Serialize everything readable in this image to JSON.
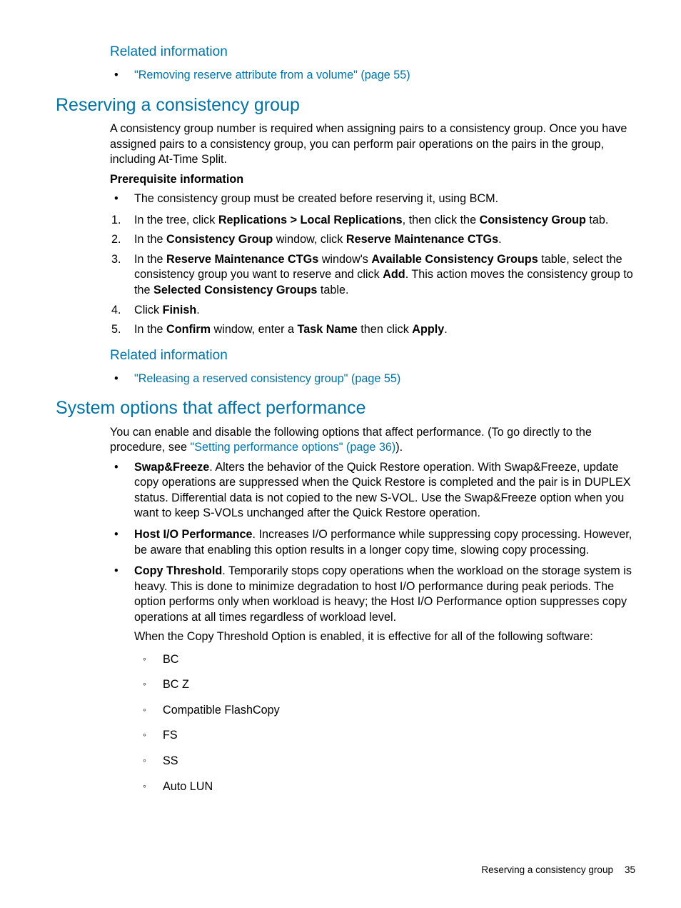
{
  "sec1": {
    "heading": "Related information",
    "link": "\"Removing reserve attribute from a volume\" (page 55)"
  },
  "sec2": {
    "heading": "Reserving a consistency group",
    "intro": "A consistency group number is required when assigning pairs to a consistency group. Once you have assigned pairs to a consistency group, you can perform pair operations on the pairs in the group, including At-Time Split.",
    "prereq_label": "Prerequisite information",
    "prereq_bullet": "The consistency group must be created before reserving it, using BCM.",
    "step1_a": "In the tree, click ",
    "step1_b": "Replications > Local Replications",
    "step1_c": ", then click the ",
    "step1_d": "Consistency Group",
    "step1_e": " tab.",
    "step2_a": "In the ",
    "step2_b": "Consistency Group",
    "step2_c": " window, click ",
    "step2_d": "Reserve Maintenance CTGs",
    "step2_e": ".",
    "step3_a": "In the ",
    "step3_b": "Reserve Maintenance CTGs",
    "step3_c": " window's ",
    "step3_d": "Available Consistency Groups",
    "step3_e": " table, select the consistency group you want to reserve and click ",
    "step3_f": "Add",
    "step3_g": ". This action moves the consistency group to the ",
    "step3_h": "Selected Consistency Groups",
    "step3_i": " table.",
    "step4_a": "Click ",
    "step4_b": "Finish",
    "step4_c": ".",
    "step5_a": "In the ",
    "step5_b": "Confirm",
    "step5_c": " window, enter a ",
    "step5_d": "Task Name",
    "step5_e": " then click ",
    "step5_f": "Apply",
    "step5_g": ".",
    "related_heading": "Related information",
    "related_link": "\"Releasing a reserved consistency group\" (page 55)"
  },
  "sec3": {
    "heading": "System options that affect performance",
    "intro_a": "You can enable and disable the following options that affect performance. (To go directly to the procedure, see ",
    "intro_link": "\"Setting performance options\" (page 36)",
    "intro_b": ").",
    "b1_name": "Swap&Freeze",
    "b1_text": ". Alters the behavior of the Quick Restore operation. With Swap&Freeze, update copy operations are suppressed when the Quick Restore is completed and the pair is in DUPLEX status. Differential data is not copied to the new S-VOL. Use the Swap&Freeze option when you want to keep S-VOLs unchanged after the Quick Restore operation.",
    "b2_name": "Host I/O Performance",
    "b2_text": ". Increases I/O performance while suppressing copy processing. However, be aware that enabling this option results in a longer copy time, slowing copy processing.",
    "b3_name": "Copy Threshold",
    "b3_text": ". Temporarily stops copy operations when the workload on the storage system is heavy. This is done to minimize degradation to host I/O performance during peak periods. The option performs only when workload is heavy; the Host I/O Performance option suppresses copy operations at all times regardless of workload level.",
    "b3_sub": "When the Copy Threshold Option is enabled, it is effective for all of the following software:",
    "sw": {
      "i1": "BC",
      "i2": "BC Z",
      "i3": "Compatible FlashCopy",
      "i4": "FS",
      "i5": "SS",
      "i6": "Auto LUN"
    }
  },
  "footer": {
    "text": "Reserving a consistency group",
    "page": "35"
  }
}
